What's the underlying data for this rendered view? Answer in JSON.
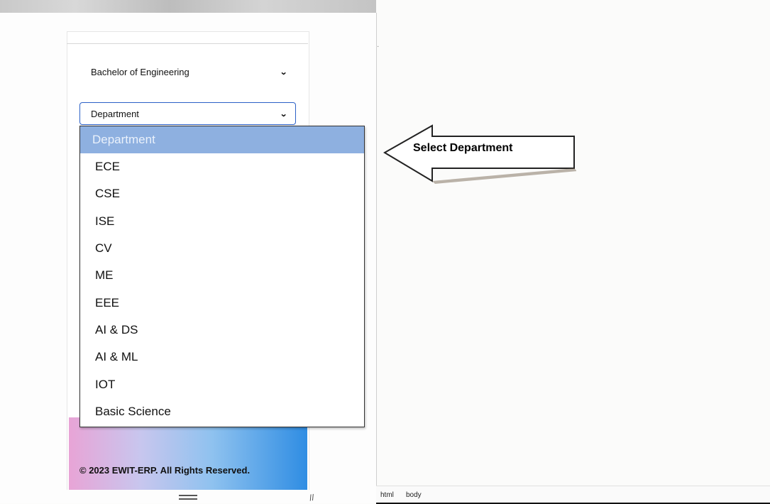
{
  "form": {
    "degree_select_value": "Bachelor of Engineering",
    "department_select_value": "Department"
  },
  "dropdown": {
    "options": [
      "Department",
      "ECE",
      "CSE",
      "ISE",
      "CV",
      "ME",
      "EEE",
      "AI & DS",
      "AI & ML",
      "IOT",
      "Basic Science"
    ],
    "selected_index": 0
  },
  "footer": {
    "copyright": "© 2023 EWIT-ERP. All Rights Reserved."
  },
  "annotation": {
    "arrow_label": "Select Department"
  },
  "statusbar": {
    "crumb_html": "html",
    "crumb_body": "body"
  },
  "colors": {
    "selected_option_bg": "#8eb0e0",
    "focus_border": "#2c61c7",
    "footer_gradient_end": "#2f8de3"
  }
}
